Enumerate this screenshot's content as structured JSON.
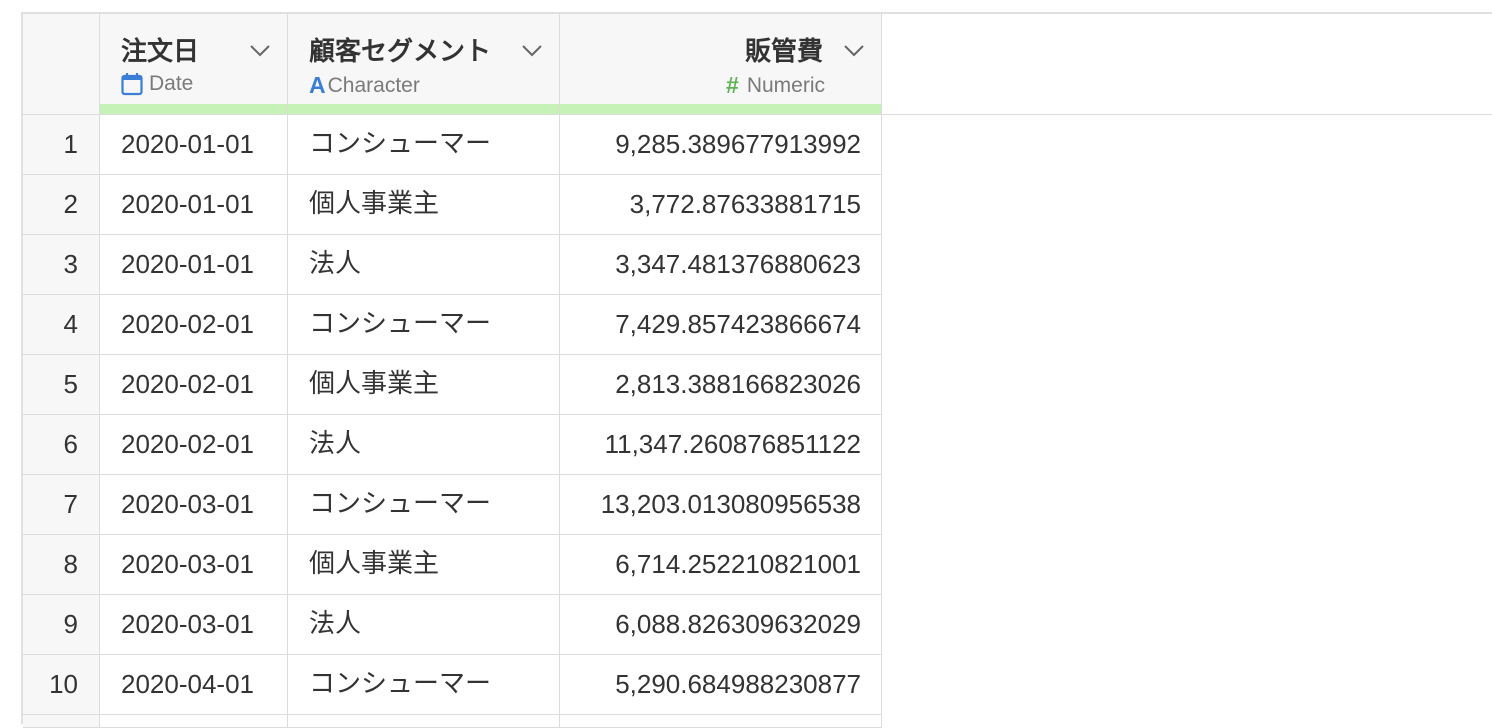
{
  "columns": [
    {
      "name": "注文日",
      "type_label": "Date",
      "type_icon": "calendar-icon"
    },
    {
      "name": "顧客セグメント",
      "type_label": "Character",
      "type_icon": "character-type-icon"
    },
    {
      "name": "販管費",
      "type_label": "Numeric",
      "type_icon": "numeric-type-icon"
    }
  ],
  "colors": {
    "date_icon": "#3a7fd5",
    "character_icon": "#3a7fd5",
    "numeric_icon": "#5fb356",
    "header_bar": "#c6f2b8"
  },
  "rows": [
    {
      "n": "1",
      "date": "2020-01-01",
      "segment": "コンシューマー",
      "value": "9,285.389677913992"
    },
    {
      "n": "2",
      "date": "2020-01-01",
      "segment": "個人事業主",
      "value": "3,772.87633881715"
    },
    {
      "n": "3",
      "date": "2020-01-01",
      "segment": "法人",
      "value": "3,347.481376880623"
    },
    {
      "n": "4",
      "date": "2020-02-01",
      "segment": "コンシューマー",
      "value": "7,429.857423866674"
    },
    {
      "n": "5",
      "date": "2020-02-01",
      "segment": "個人事業主",
      "value": "2,813.388166823026"
    },
    {
      "n": "6",
      "date": "2020-02-01",
      "segment": "法人",
      "value": "11,347.260876851122"
    },
    {
      "n": "7",
      "date": "2020-03-01",
      "segment": "コンシューマー",
      "value": "13,203.013080956538"
    },
    {
      "n": "8",
      "date": "2020-03-01",
      "segment": "個人事業主",
      "value": "6,714.252210821001"
    },
    {
      "n": "9",
      "date": "2020-03-01",
      "segment": "法人",
      "value": "6,088.826309632029"
    },
    {
      "n": "10",
      "date": "2020-04-01",
      "segment": "コンシューマー",
      "value": "5,290.684988230877"
    }
  ]
}
